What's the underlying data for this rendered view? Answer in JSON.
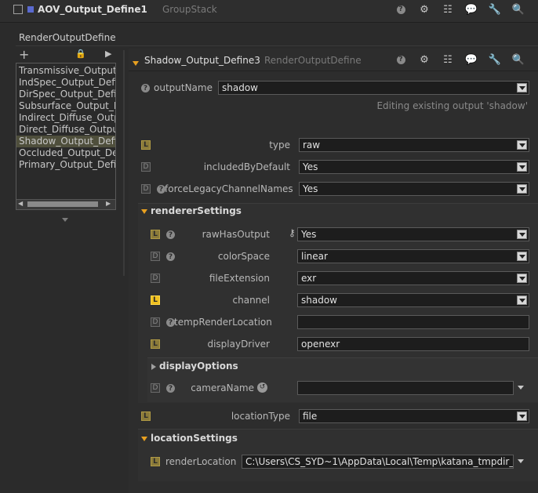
{
  "header": {
    "title": "AOV_Output_Define1",
    "subtitle": "GroupStack"
  },
  "node_type_label": "RenderOutputDefine",
  "list": {
    "items": [
      "Transmissive_Output_",
      "IndSpec_Output_Defi",
      "DirSpec_Output_Defi",
      "Subsurface_Output_D",
      "Indirect_Diffuse_Outp",
      "Direct_Diffuse_Outpu",
      "Shadow_Output_Defi",
      "Occluded_Output_Def",
      "Primary_Output_Defi"
    ],
    "selected_index": 6
  },
  "panel": {
    "title": "Shadow_Output_Define3",
    "subtitle": "RenderOutputDefine",
    "outputName": {
      "label": "outputName",
      "value": "shadow"
    },
    "editing_note": "Editing existing output 'shadow'",
    "type": {
      "label": "type",
      "value": "raw"
    },
    "includedByDefault": {
      "label": "includedByDefault",
      "value": "Yes"
    },
    "forceLegacyChannelNames": {
      "label": "forceLegacyChannelNames",
      "value": "Yes"
    },
    "rendererSettings": {
      "label": "rendererSettings",
      "rawHasOutput": {
        "label": "rawHasOutput",
        "value": "Yes"
      },
      "colorSpace": {
        "label": "colorSpace",
        "value": "linear"
      },
      "fileExtension": {
        "label": "fileExtension",
        "value": "exr"
      },
      "channel": {
        "label": "channel",
        "value": "shadow"
      },
      "tempRenderLocation": {
        "label": "tempRenderLocation",
        "value": ""
      },
      "displayDriver": {
        "label": "displayDriver",
        "value": "openexr"
      },
      "displayOptions": {
        "label": "displayOptions"
      },
      "cameraName": {
        "label": "cameraName",
        "value": ""
      }
    },
    "locationType": {
      "label": "locationType",
      "value": "file"
    },
    "locationSettings": {
      "label": "locationSettings",
      "renderLocation": {
        "label": "renderLocation",
        "value": "C:\\Users\\CS_SYD~1\\AppData\\Local\\Temp\\katana_tmpdir_"
      }
    }
  },
  "badges": {
    "L": "L",
    "D": "D"
  },
  "icons": [
    "node-icon",
    "help-icon",
    "gear-icon",
    "hierarchy-icon",
    "comment-icon",
    "wrench-icon",
    "search-icon",
    "plus-icon",
    "lock-icon",
    "arrow-icon",
    "key-icon",
    "history-icon"
  ]
}
